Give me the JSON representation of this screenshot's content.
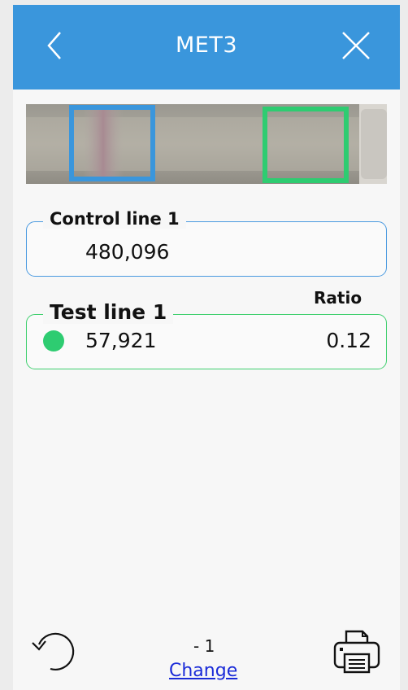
{
  "header": {
    "title": "MET3",
    "back_icon": "chevron-left-icon",
    "close_icon": "close-icon",
    "background": "#3a96dc"
  },
  "strip": {
    "control_zone_color": "#3a96dc",
    "test_zone_color": "#2ecc71"
  },
  "control": {
    "label": "Control line 1",
    "value": "480,096",
    "border_color": "#4a9ae0"
  },
  "test": {
    "label": "Test line 1",
    "value": "57,921",
    "ratio_header": "Ratio",
    "ratio": "0.12",
    "status_color": "#2ecc71",
    "border_color": "#3fcf6e"
  },
  "footer": {
    "page_label": "- 1",
    "change_label": "Change",
    "refresh_icon": "refresh-icon",
    "print_icon": "printer-icon"
  }
}
